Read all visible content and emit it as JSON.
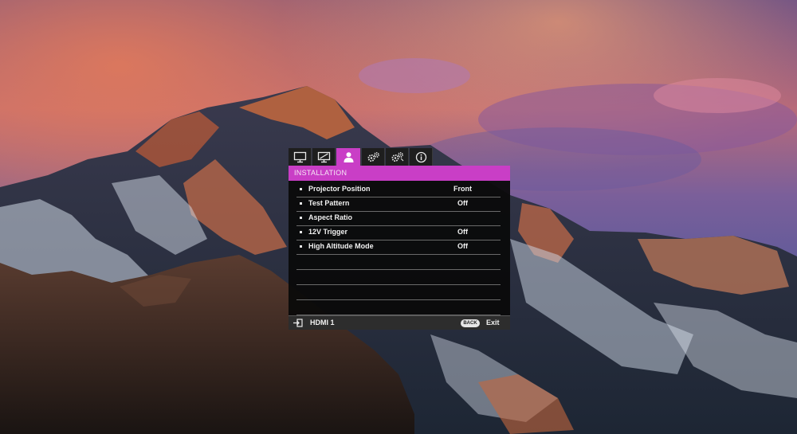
{
  "osd": {
    "tabs": [
      {
        "icon": "display-icon"
      },
      {
        "icon": "picture-adjust-icon"
      },
      {
        "icon": "installation-person-icon",
        "active": true
      },
      {
        "icon": "settings-gears-icon"
      },
      {
        "icon": "advanced-settings-gears-icon"
      },
      {
        "icon": "info-icon"
      }
    ],
    "title": "INSTALLATION",
    "items": [
      {
        "label": "Projector Position",
        "value": "Front"
      },
      {
        "label": "Test Pattern",
        "value": "Off"
      },
      {
        "label": "Aspect Ratio",
        "value": ""
      },
      {
        "label": "12V Trigger",
        "value": "Off"
      },
      {
        "label": "High Altitude Mode",
        "value": "Off"
      },
      {
        "label": "",
        "value": ""
      },
      {
        "label": "",
        "value": ""
      },
      {
        "label": "",
        "value": ""
      },
      {
        "label": "",
        "value": ""
      }
    ],
    "footer": {
      "source_label": "HDMI 1",
      "back_label": "BACK",
      "exit_label": "Exit"
    },
    "colors": {
      "accent": "#c93ec6",
      "panel": "#0a0a0a",
      "footer": "#2d2d2d"
    }
  }
}
